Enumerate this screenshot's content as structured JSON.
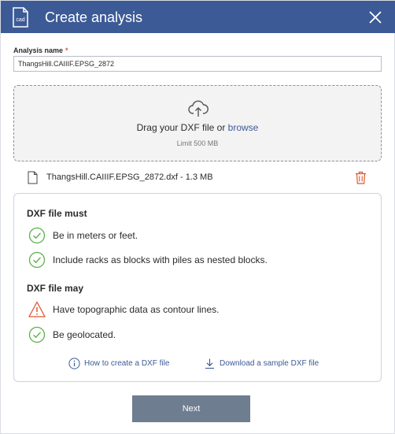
{
  "header": {
    "title": "Create analysis",
    "icon": "cad-file-icon",
    "icon_label": "cad",
    "close_icon": "close-icon",
    "color": "#3c5a96"
  },
  "form": {
    "label": "Analysis name",
    "required_mark": "*",
    "value": "ThangsHill.CAIIIF.EPSG_2872"
  },
  "dropzone": {
    "text": "Drag your DXF file or ",
    "browse": "browse",
    "limit": "Limit 500 MB",
    "icon": "cloud-upload-icon"
  },
  "file": {
    "name": "ThangsHill.CAIIIF.EPSG_2872.dxf - 1.3 MB",
    "icon": "file-icon",
    "delete_icon": "trash-icon"
  },
  "requirements": {
    "must_title": "DXF file must",
    "must": [
      {
        "text": "Be in meters or feet.",
        "status": "ok"
      },
      {
        "text": "Include racks as blocks with piles as nested blocks.",
        "status": "ok"
      }
    ],
    "may_title": "DXF file may",
    "may": [
      {
        "text": "Have topographic data as contour lines.",
        "status": "warning"
      },
      {
        "text": "Be geolocated.",
        "status": "ok"
      }
    ],
    "links": [
      {
        "text": "How to create a DXF file",
        "icon": "info-icon"
      },
      {
        "text": "Download a sample DXF file",
        "icon": "download-icon"
      }
    ]
  },
  "actions": {
    "next": "Next"
  },
  "colors": {
    "ok": "#5bb14a",
    "warning": "#e2552f",
    "link": "#3c5a96",
    "button": "#6e7d8f"
  }
}
